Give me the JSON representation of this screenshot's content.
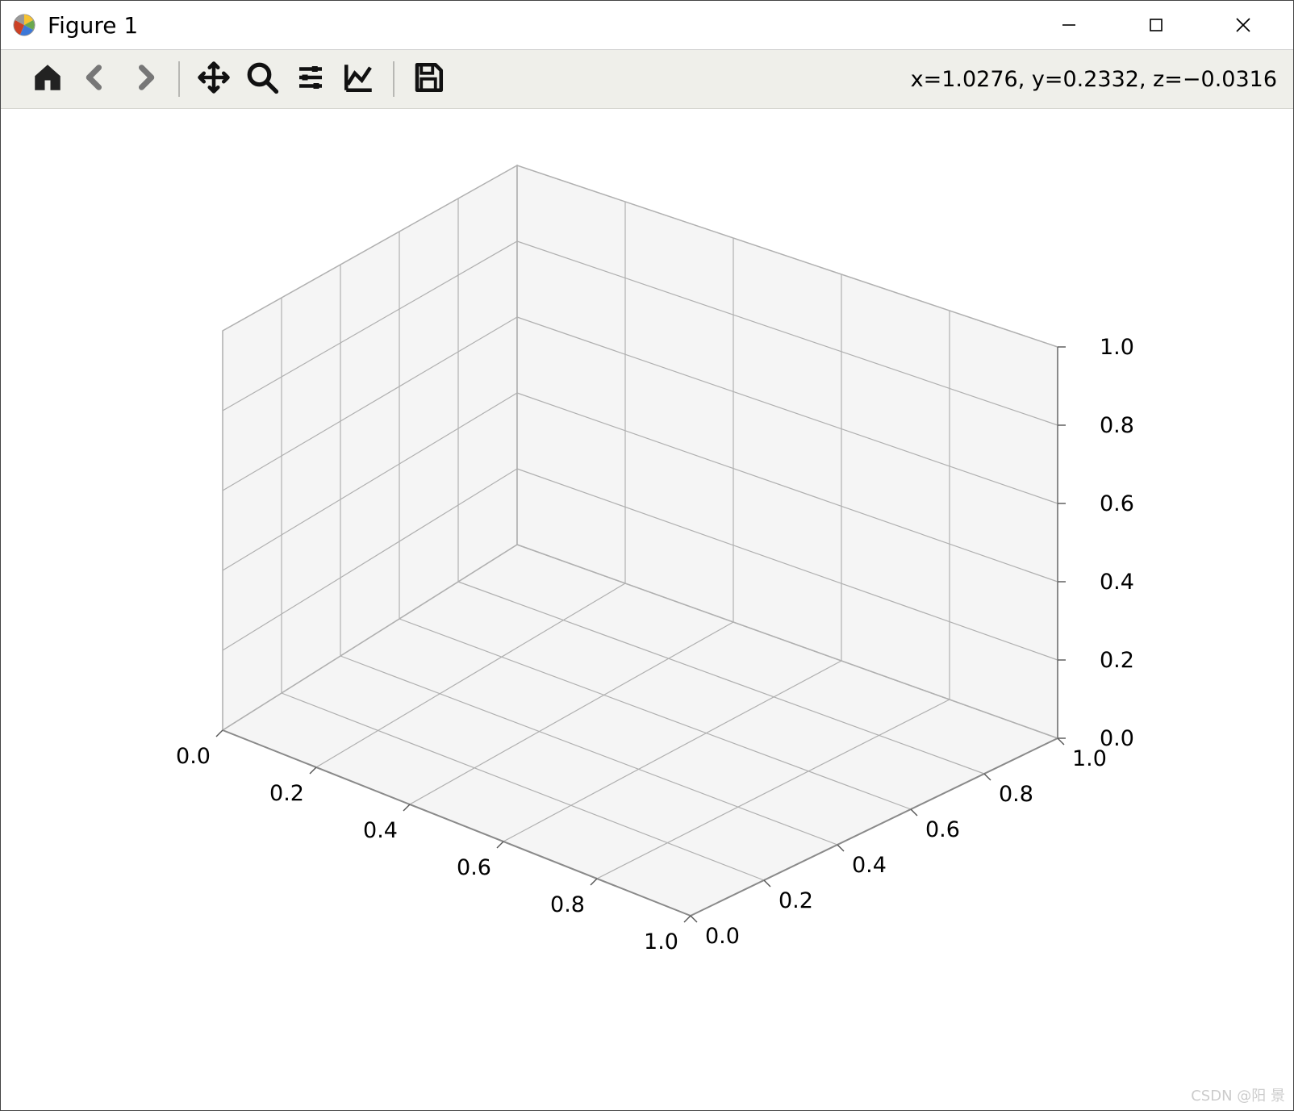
{
  "window": {
    "title": "Figure 1"
  },
  "toolbar": {
    "coord_readout": "x=1.0276, y=0.2332, z=−0.0316"
  },
  "watermark": "CSDN @阳 景",
  "chart_data": {
    "type": "3d-axes",
    "title": "",
    "xlabel": "",
    "ylabel": "",
    "zlabel": "",
    "x_ticks": [
      0.0,
      0.2,
      0.4,
      0.6,
      0.8,
      1.0
    ],
    "y_ticks": [
      0.0,
      0.2,
      0.4,
      0.6,
      0.8,
      1.0
    ],
    "z_ticks": [
      0.0,
      0.2,
      0.4,
      0.6,
      0.8,
      1.0
    ],
    "x_range": [
      0.0,
      1.0
    ],
    "y_range": [
      0.0,
      1.0
    ],
    "z_range": [
      0.0,
      1.0
    ],
    "series": [],
    "grid": true,
    "cursor": {
      "x": 1.0276,
      "y": 0.2332,
      "z": -0.0316
    }
  }
}
